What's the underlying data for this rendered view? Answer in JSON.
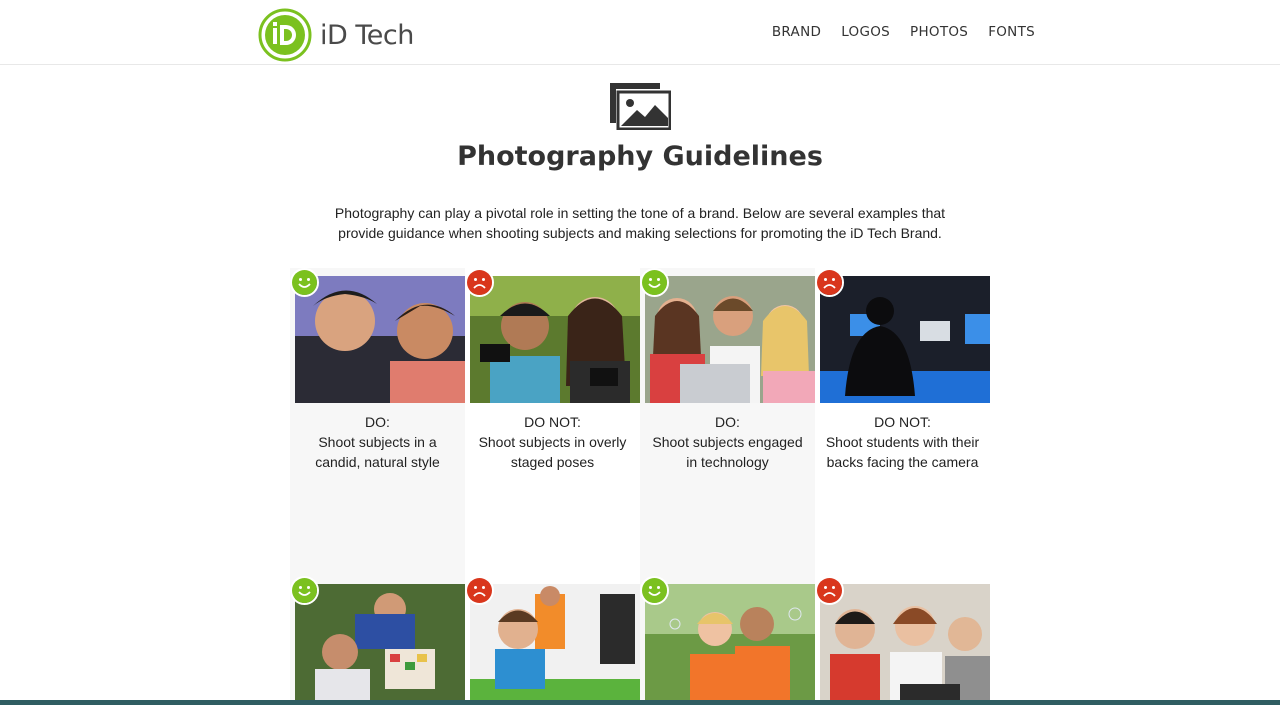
{
  "brand": {
    "name": "iD Tech",
    "mark_letters": "iD",
    "accent_color": "#7bc11f"
  },
  "nav": [
    {
      "label": "BRAND"
    },
    {
      "label": "LOGOS"
    },
    {
      "label": "PHOTOS"
    },
    {
      "label": "FONTS"
    }
  ],
  "page": {
    "icon": "photo-gallery-icon",
    "title": "Photography Guidelines",
    "intro": "Photography can play a pivotal role in setting the tone of a brand. Below are several examples that provide guidance when shooting subjects and making selections for promoting the iD Tech Brand."
  },
  "colors": {
    "do": "#7bc11f",
    "dont": "#d9361c"
  },
  "cards": [
    {
      "verdict": "DO:",
      "description": "Shoot subjects in a candid, natural style",
      "badge": "happy-face-icon",
      "photo": "kids-laughing-photo"
    },
    {
      "verdict": "DO NOT:",
      "description": "Shoot subjects in overly staged poses",
      "badge": "sad-face-icon",
      "photo": "kids-with-cameras-photo"
    },
    {
      "verdict": "DO:",
      "description": "Shoot subjects engaged in technology",
      "badge": "happy-face-icon",
      "photo": "teens-at-laptop-photo"
    },
    {
      "verdict": "DO NOT:",
      "description": "Shoot students with their backs facing the camera",
      "badge": "sad-face-icon",
      "photo": "student-back-turned-photo"
    },
    {
      "verdict": "",
      "description": "",
      "badge": "happy-face-icon",
      "photo": "kids-playing-cards-photo"
    },
    {
      "verdict": "",
      "description": "",
      "badge": "sad-face-icon",
      "photo": "kid-at-computer-photo"
    },
    {
      "verdict": "",
      "description": "",
      "badge": "happy-face-icon",
      "photo": "kids-orange-shirts-photo"
    },
    {
      "verdict": "",
      "description": "",
      "badge": "sad-face-icon",
      "photo": "boys-with-lanyards-photo"
    }
  ]
}
